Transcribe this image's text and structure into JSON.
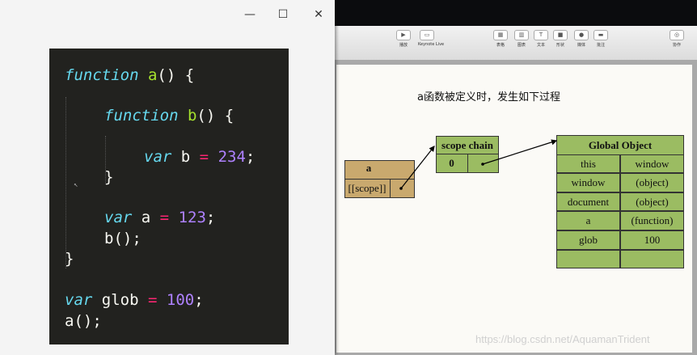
{
  "editor_window": {
    "controls": {
      "minimize": "—",
      "maximize": "☐",
      "close": "✕"
    },
    "code_lines": [
      [
        {
          "t": "function",
          "c": "kw"
        },
        {
          "t": " ",
          "c": ""
        },
        {
          "t": "a",
          "c": "fn"
        },
        {
          "t": "() {",
          "c": ""
        }
      ],
      [
        {
          "t": "function",
          "c": "kw"
        },
        {
          "t": " ",
          "c": ""
        },
        {
          "t": "b",
          "c": "fn"
        },
        {
          "t": "() {",
          "c": ""
        }
      ],
      [
        {
          "t": "var",
          "c": "kw"
        },
        {
          "t": " b ",
          "c": ""
        },
        {
          "t": "=",
          "c": "op"
        },
        {
          "t": " ",
          "c": ""
        },
        {
          "t": "234",
          "c": "num"
        },
        {
          "t": ";",
          "c": ""
        }
      ],
      [
        {
          "t": "}",
          "c": ""
        }
      ],
      [
        {
          "t": "var",
          "c": "kw"
        },
        {
          "t": " a ",
          "c": ""
        },
        {
          "t": "=",
          "c": "op"
        },
        {
          "t": " ",
          "c": ""
        },
        {
          "t": "123",
          "c": "num"
        },
        {
          "t": ";",
          "c": ""
        }
      ],
      [
        {
          "t": "b();",
          "c": ""
        }
      ],
      [
        {
          "t": "}",
          "c": ""
        }
      ],
      [
        {
          "t": "var",
          "c": "kw"
        },
        {
          "t": " glob ",
          "c": ""
        },
        {
          "t": "=",
          "c": "op"
        },
        {
          "t": " ",
          "c": ""
        },
        {
          "t": "100",
          "c": "num"
        },
        {
          "t": ";",
          "c": ""
        }
      ],
      [
        {
          "t": "a();",
          "c": ""
        }
      ]
    ],
    "syntax_colors": {
      "keyword": "#66d9ef",
      "function_name": "#a6e22e",
      "operator": "#f92672",
      "number": "#ae81ff",
      "text": "#f8f8f2",
      "background": "#22221f"
    }
  },
  "keynote": {
    "toolbar": [
      {
        "icon": "play-icon",
        "glyph": "▶",
        "label": "播放"
      },
      {
        "icon": "keynote-live-icon",
        "glyph": "▭",
        "label": "Keynote Live"
      },
      {
        "icon": "table-icon",
        "glyph": "▦",
        "label": "表格"
      },
      {
        "icon": "chart-icon",
        "glyph": "▥",
        "label": "图表"
      },
      {
        "icon": "text-icon",
        "glyph": "T",
        "label": "文本"
      },
      {
        "icon": "shape-icon",
        "glyph": "■",
        "label": "形状"
      },
      {
        "icon": "media-icon",
        "glyph": "●",
        "label": "媒体"
      },
      {
        "icon": "comment-icon",
        "glyph": "▬",
        "label": "批注"
      },
      {
        "icon": "collaborate-icon",
        "glyph": "◎",
        "label": "协作"
      }
    ],
    "slide": {
      "heading": "a函数被定义时，发生如下过程",
      "func_box": {
        "name": "a",
        "slot": "[[scope]]"
      },
      "scope_chain": {
        "title": "scope chain",
        "index": "0"
      },
      "global_object": {
        "title": "Global Object",
        "rows": [
          [
            "this",
            "window"
          ],
          [
            "window",
            "(object)"
          ],
          [
            "document",
            "(object)"
          ],
          [
            "a",
            "(function)"
          ],
          [
            "glob",
            "100"
          ],
          [
            "",
            ""
          ]
        ]
      },
      "colors": {
        "function_box": "#c9a96e",
        "scope_box": "#9bbc62"
      }
    },
    "watermark": "https://blog.csdn.net/AquamanTrident"
  }
}
